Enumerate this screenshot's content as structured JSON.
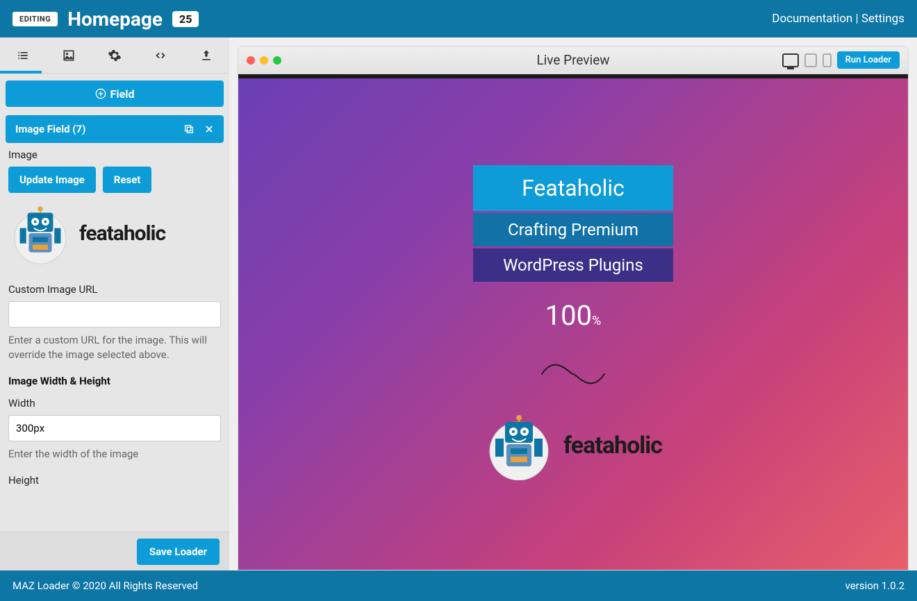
{
  "topbar": {
    "editing_badge": "EDITING",
    "title": "Homepage",
    "count": "25",
    "doc_link": "Documentation",
    "settings_link": "Settings"
  },
  "sidebar": {
    "add_field_label": "Field",
    "field_item_label": "Image Field (7)",
    "image_section_label": "Image",
    "update_image_btn": "Update Image",
    "reset_btn": "Reset",
    "brand_text": "feataholic",
    "custom_url_label": "Custom Image URL",
    "custom_url_value": "",
    "custom_url_help": "Enter a custom URL for the image. This will override the image selected above.",
    "dim_header": "Image Width & Height",
    "width_label": "Width",
    "width_value": "300px",
    "width_help": "Enter the width of the image",
    "height_label": "Height",
    "save_loader_btn": "Save Loader"
  },
  "preview": {
    "title": "Live Preview",
    "run_btn": "Run Loader",
    "box1": "Feataholic",
    "box2": "Crafting Premium",
    "box3": "WordPress Plugins",
    "percent": "100",
    "percent_suffix": "%",
    "brand_text": "feataholic"
  },
  "footer": {
    "copyright": "MAZ Loader © 2020 All Rights Reserved",
    "version": "version 1.0.2"
  }
}
